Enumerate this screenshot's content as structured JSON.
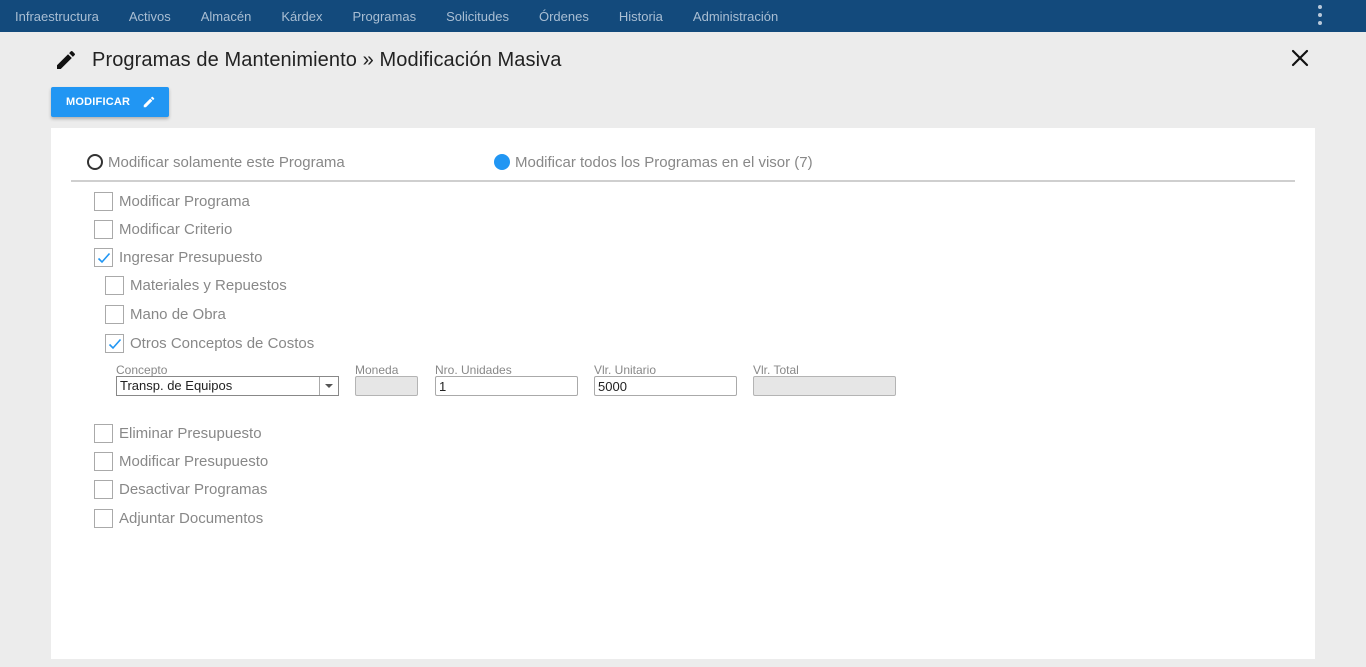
{
  "nav": {
    "items": [
      "Infraestructura",
      "Activos",
      "Almacén",
      "Kárdex",
      "Programas",
      "Solicitudes",
      "Órdenes",
      "Historia",
      "Administración"
    ],
    "menu_icon": "more-vert-icon"
  },
  "header": {
    "title": "Programas de Mantenimiento » Modificación Masiva",
    "title_icon": "pencil-icon",
    "close_icon": "close-icon"
  },
  "toolbar": {
    "modify_label": "MODIFICAR",
    "modify_icon": "pencil-icon"
  },
  "scope": {
    "option_single": "Modificar solamente este Programa",
    "option_all": "Modificar todos los Programas en el visor (7)",
    "selected": "option_all"
  },
  "options": {
    "modificar_programa": {
      "label": "Modificar Programa",
      "checked": false
    },
    "modificar_criterio": {
      "label": "Modificar Criterio",
      "checked": false
    },
    "ingresar_presupuesto": {
      "label": "Ingresar Presupuesto",
      "checked": true
    },
    "materiales_repuestos": {
      "label": "Materiales y Repuestos",
      "checked": false
    },
    "mano_obra": {
      "label": "Mano de Obra",
      "checked": false
    },
    "otros_conceptos": {
      "label": "Otros Conceptos de Costos",
      "checked": true
    },
    "eliminar_presupuesto": {
      "label": "Eliminar Presupuesto",
      "checked": false
    },
    "modificar_presupuesto": {
      "label": "Modificar Presupuesto",
      "checked": false
    },
    "desactivar_programas": {
      "label": "Desactivar Programas",
      "checked": false
    },
    "adjuntar_documentos": {
      "label": "Adjuntar Documentos",
      "checked": false
    }
  },
  "cost_form": {
    "concepto": {
      "label": "Concepto",
      "value": "Transp. de Equipos"
    },
    "moneda": {
      "label": "Moneda",
      "value": ""
    },
    "nro_unidades": {
      "label": "Nro. Unidades",
      "value": "1"
    },
    "vlr_unitario": {
      "label": "Vlr. Unitario",
      "value": "5000"
    },
    "vlr_total": {
      "label": "Vlr. Total",
      "value": ""
    }
  },
  "colors": {
    "nav_bg": "#134a7c",
    "accent": "#2196f3",
    "page_bg": "#ececec"
  }
}
